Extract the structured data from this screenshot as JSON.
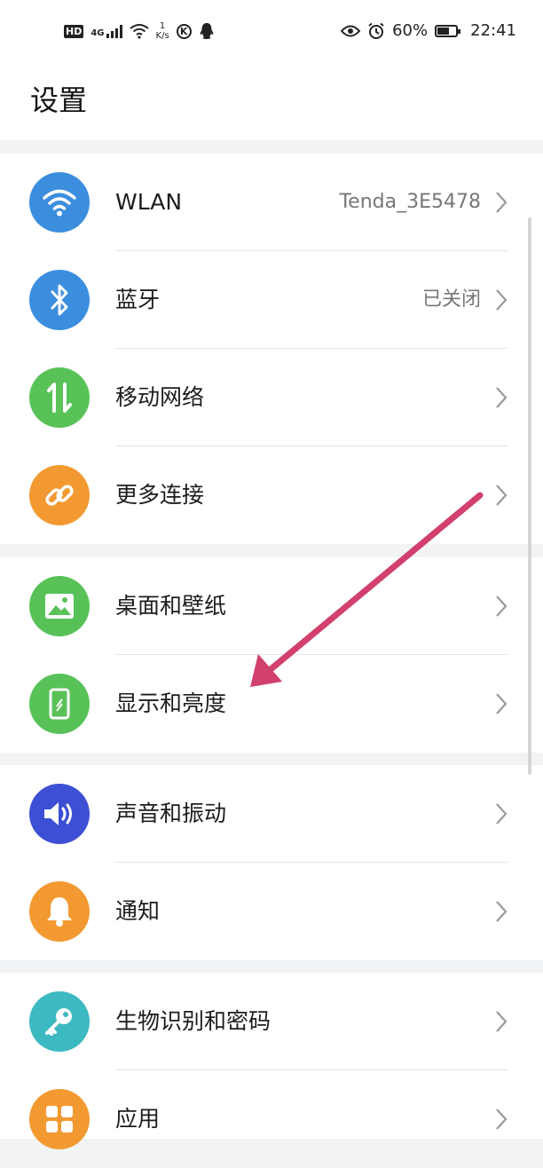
{
  "status_bar": {
    "hd": "HD",
    "network": "4G",
    "speed_value": "1",
    "speed_unit": "K/s",
    "k_icon": "K",
    "battery": "60%",
    "time": "22:41"
  },
  "page": {
    "title": "设置"
  },
  "sections": [
    {
      "items": [
        {
          "label": "WLAN",
          "value": "Tenda_3E5478",
          "icon": "wifi-icon",
          "color": "#3b8ede"
        },
        {
          "label": "蓝牙",
          "value": "已关闭",
          "icon": "bluetooth-icon",
          "color": "#3b8ede"
        },
        {
          "label": "移动网络",
          "value": "",
          "icon": "mobile-data-icon",
          "color": "#58c259"
        },
        {
          "label": "更多连接",
          "value": "",
          "icon": "link-icon",
          "color": "#f29a31"
        }
      ]
    },
    {
      "items": [
        {
          "label": "桌面和壁纸",
          "value": "",
          "icon": "wallpaper-icon",
          "color": "#58c259"
        },
        {
          "label": "显示和亮度",
          "value": "",
          "icon": "display-icon",
          "color": "#58c259"
        }
      ]
    },
    {
      "items": [
        {
          "label": "声音和振动",
          "value": "",
          "icon": "sound-icon",
          "color": "#3d4fd4"
        },
        {
          "label": "通知",
          "value": "",
          "icon": "bell-icon",
          "color": "#f29a31"
        }
      ]
    },
    {
      "items": [
        {
          "label": "生物识别和密码",
          "value": "",
          "icon": "key-icon",
          "color": "#3cb9c1"
        },
        {
          "label": "应用",
          "value": "",
          "icon": "apps-icon",
          "color": "#f29a31"
        }
      ]
    }
  ],
  "annotation": {
    "arrow_color": "#d2406d"
  }
}
